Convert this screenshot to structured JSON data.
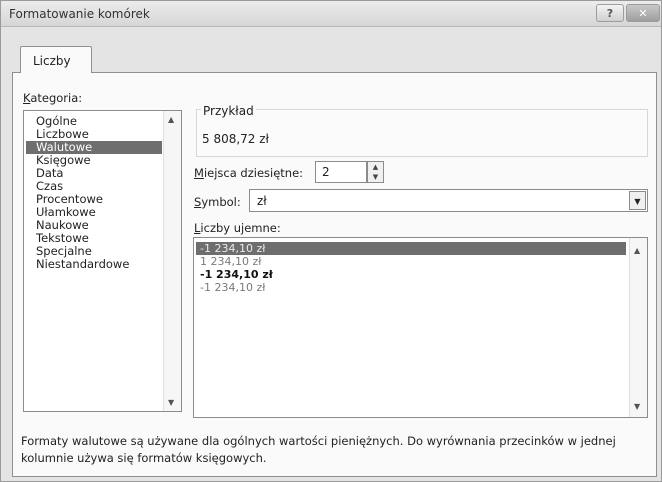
{
  "window": {
    "title": "Formatowanie komórek",
    "help_glyph": "?",
    "close_glyph": "✕"
  },
  "tabs": [
    {
      "label": "Liczby",
      "active": true
    }
  ],
  "category": {
    "label_hotkey": "K",
    "label_rest": "ategoria:",
    "items": [
      "Ogólne",
      "Liczbowe",
      "Walutowe",
      "Księgowe",
      "Data",
      "Czas",
      "Procentowe",
      "Ułamkowe",
      "Naukowe",
      "Tekstowe",
      "Specjalne",
      "Niestandardowe"
    ],
    "selected_index": 2
  },
  "sample": {
    "label": "Przykład",
    "value": "5 808,72 zł"
  },
  "decimal_places": {
    "label_hotkey": "M",
    "label_rest": "iejsca dziesiętne:",
    "value": "2"
  },
  "symbol": {
    "label_hotkey": "S",
    "label_rest": "ymbol:",
    "value": "zł"
  },
  "negative_numbers": {
    "label_hotkey": "L",
    "label_rest": "iczby ujemne:",
    "items": [
      "-1 234,10 zł",
      "1 234,10 zł",
      "-1 234,10 zł",
      "-1 234,10 zł"
    ],
    "selected_index": 0
  },
  "description": "Formaty walutowe są używane dla ogólnych wartości pieniężnych. Do wyrównania przecinków w jednej kolumnie używa się formatów księgowych.",
  "colors": {
    "selection": "#6e6e6e",
    "dialog_bg": "#e4e4e4",
    "panel_bg": "#fafafa"
  }
}
